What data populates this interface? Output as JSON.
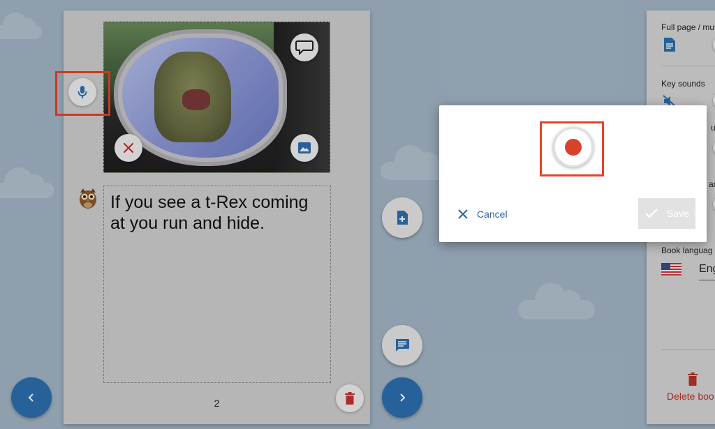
{
  "page": {
    "story_text": "If you see a t-Rex coming at you run and hide.",
    "page_number": "2"
  },
  "settings_panel": {
    "full_page_label": "Full page / mu",
    "key_sounds_label": "Key sounds",
    "partial_label_1": "un",
    "partial_label_2": "ar",
    "book_language_label": "Book languag",
    "book_language_value": "Eng",
    "delete_book_label": "Delete boo"
  },
  "dialog": {
    "cancel_label": "Cancel",
    "save_label": "Save"
  },
  "colors": {
    "accent_blue": "#2d6fb0",
    "record_red": "#d8412a",
    "highlight_red": "#e8412a",
    "delete_red": "#b8342a"
  },
  "icons": {
    "mic": "mic-icon",
    "speech_bubble": "speech-bubble-icon",
    "remove": "close-icon",
    "image": "image-icon",
    "add_page": "add-page-icon",
    "comment": "comment-icon",
    "prev": "chevron-left-icon",
    "next": "chevron-right-icon",
    "trash": "trash-icon",
    "document": "document-icon",
    "sound_off": "sound-off-icon",
    "record": "record-icon",
    "check": "check-icon"
  }
}
